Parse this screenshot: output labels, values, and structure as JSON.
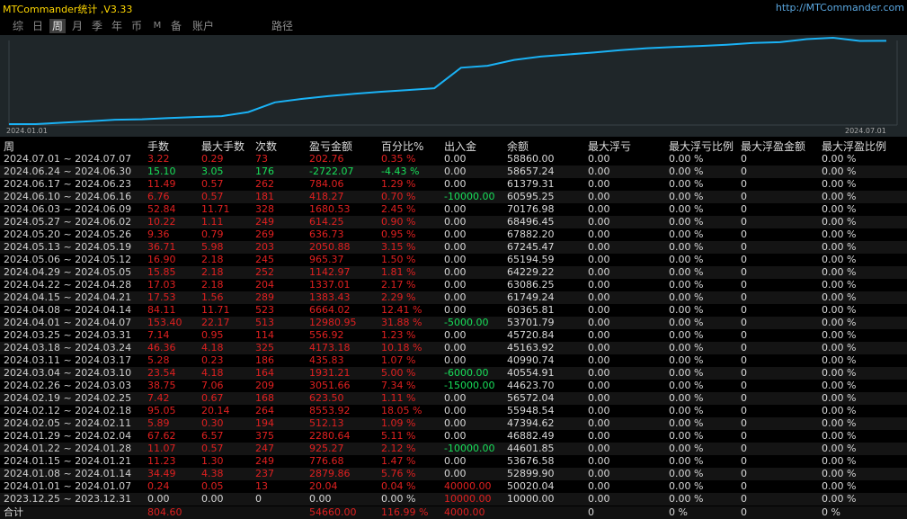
{
  "app": {
    "title": "MTCommander统计 ,V3.33",
    "url": "http://MTCommander.com"
  },
  "tabs": [
    {
      "label": "综",
      "active": false
    },
    {
      "label": "日",
      "active": false
    },
    {
      "label": "周",
      "active": true
    },
    {
      "label": "月",
      "active": false
    },
    {
      "label": "季",
      "active": false
    },
    {
      "label": "年",
      "active": false
    },
    {
      "label": "币",
      "active": false
    },
    {
      "label": "M",
      "active": false
    },
    {
      "label": "备",
      "active": false
    },
    {
      "label": "账户",
      "active": false
    },
    {
      "label": "路径",
      "active": false
    }
  ],
  "chart_data": {
    "type": "line",
    "x_start_label": "2024.01.01",
    "x_end_label": "2024.07.01",
    "series_color": "#1ab2f5",
    "grid": false,
    "values": [
      10000.0,
      10020.04,
      10796.72,
      11573.4,
      12498.67,
      12748.91,
      13460.0,
      14005.37,
      14520.12,
      16808.41,
      22335.7,
      24268.95,
      25862.33,
      27147.67,
      28345.25,
      29302.27,
      30339.7,
      41924.94,
      43049.76,
      46380.17,
      48244.88,
      49427.9,
      50571.39,
      51907.83,
      53016.2,
      53649.65,
      54280.32,
      54955.31,
      55961.27,
      56380.33,
      58116.25,
      58900.25,
      57127.64,
      57185.4
    ]
  },
  "table": {
    "headers": [
      "周",
      "手数",
      "最大手数",
      "次数",
      "盈亏金额",
      "百分比%",
      "出入金",
      "余额",
      "最大浮亏",
      "最大浮亏比例",
      "最大浮盈金额",
      "最大浮盈比例"
    ],
    "rows": [
      [
        "2024.07.01 ~ 2024.07.07",
        "3.22",
        "0.29",
        "73",
        "202.76",
        "0.35 %",
        "0.00",
        "58860.00",
        "0.00",
        "0.00 %",
        "0",
        "0.00 %"
      ],
      [
        "2024.06.24 ~ 2024.06.30",
        "15.10",
        "3.05",
        "176",
        "-2722.07",
        "-4.43 %",
        "0.00",
        "58657.24",
        "0.00",
        "0.00 %",
        "0",
        "0.00 %"
      ],
      [
        "2024.06.17 ~ 2024.06.23",
        "11.49",
        "0.57",
        "262",
        "784.06",
        "1.29 %",
        "0.00",
        "61379.31",
        "0.00",
        "0.00 %",
        "0",
        "0.00 %"
      ],
      [
        "2024.06.10 ~ 2024.06.16",
        "6.76",
        "0.57",
        "181",
        "418.27",
        "0.70 %",
        "-10000.00",
        "60595.25",
        "0.00",
        "0.00 %",
        "0",
        "0.00 %"
      ],
      [
        "2024.06.03 ~ 2024.06.09",
        "52.84",
        "11.71",
        "328",
        "1680.53",
        "2.45 %",
        "0.00",
        "70176.98",
        "0.00",
        "0.00 %",
        "0",
        "0.00 %"
      ],
      [
        "2024.05.27 ~ 2024.06.02",
        "10.22",
        "1.11",
        "249",
        "614.25",
        "0.90 %",
        "0.00",
        "68496.45",
        "0.00",
        "0.00 %",
        "0",
        "0.00 %"
      ],
      [
        "2024.05.20 ~ 2024.05.26",
        "9.36",
        "0.79",
        "269",
        "636.73",
        "0.95 %",
        "0.00",
        "67882.20",
        "0.00",
        "0.00 %",
        "0",
        "0.00 %"
      ],
      [
        "2024.05.13 ~ 2024.05.19",
        "36.71",
        "5.98",
        "203",
        "2050.88",
        "3.15 %",
        "0.00",
        "67245.47",
        "0.00",
        "0.00 %",
        "0",
        "0.00 %"
      ],
      [
        "2024.05.06 ~ 2024.05.12",
        "16.90",
        "2.18",
        "245",
        "965.37",
        "1.50 %",
        "0.00",
        "65194.59",
        "0.00",
        "0.00 %",
        "0",
        "0.00 %"
      ],
      [
        "2024.04.29 ~ 2024.05.05",
        "15.85",
        "2.18",
        "252",
        "1142.97",
        "1.81 %",
        "0.00",
        "64229.22",
        "0.00",
        "0.00 %",
        "0",
        "0.00 %"
      ],
      [
        "2024.04.22 ~ 2024.04.28",
        "17.03",
        "2.18",
        "204",
        "1337.01",
        "2.17 %",
        "0.00",
        "63086.25",
        "0.00",
        "0.00 %",
        "0",
        "0.00 %"
      ],
      [
        "2024.04.15 ~ 2024.04.21",
        "17.53",
        "1.56",
        "289",
        "1383.43",
        "2.29 %",
        "0.00",
        "61749.24",
        "0.00",
        "0.00 %",
        "0",
        "0.00 %"
      ],
      [
        "2024.04.08 ~ 2024.04.14",
        "84.11",
        "11.71",
        "523",
        "6664.02",
        "12.41 %",
        "0.00",
        "60365.81",
        "0.00",
        "0.00 %",
        "0",
        "0.00 %"
      ],
      [
        "2024.04.01 ~ 2024.04.07",
        "153.40",
        "22.17",
        "513",
        "12980.95",
        "31.88 %",
        "-5000.00",
        "53701.79",
        "0.00",
        "0.00 %",
        "0",
        "0.00 %"
      ],
      [
        "2024.03.25 ~ 2024.03.31",
        "7.14",
        "0.95",
        "114",
        "556.92",
        "1.23 %",
        "0.00",
        "45720.84",
        "0.00",
        "0.00 %",
        "0",
        "0.00 %"
      ],
      [
        "2024.03.18 ~ 2024.03.24",
        "46.36",
        "4.18",
        "325",
        "4173.18",
        "10.18 %",
        "0.00",
        "45163.92",
        "0.00",
        "0.00 %",
        "0",
        "0.00 %"
      ],
      [
        "2024.03.11 ~ 2024.03.17",
        "5.28",
        "0.23",
        "186",
        "435.83",
        "1.07 %",
        "0.00",
        "40990.74",
        "0.00",
        "0.00 %",
        "0",
        "0.00 %"
      ],
      [
        "2024.03.04 ~ 2024.03.10",
        "23.54",
        "4.18",
        "164",
        "1931.21",
        "5.00 %",
        "-6000.00",
        "40554.91",
        "0.00",
        "0.00 %",
        "0",
        "0.00 %"
      ],
      [
        "2024.02.26 ~ 2024.03.03",
        "38.75",
        "7.06",
        "209",
        "3051.66",
        "7.34 %",
        "-15000.00",
        "44623.70",
        "0.00",
        "0.00 %",
        "0",
        "0.00 %"
      ],
      [
        "2024.02.19 ~ 2024.02.25",
        "7.42",
        "0.67",
        "168",
        "623.50",
        "1.11 %",
        "0.00",
        "56572.04",
        "0.00",
        "0.00 %",
        "0",
        "0.00 %"
      ],
      [
        "2024.02.12 ~ 2024.02.18",
        "95.05",
        "20.14",
        "264",
        "8553.92",
        "18.05 %",
        "0.00",
        "55948.54",
        "0.00",
        "0.00 %",
        "0",
        "0.00 %"
      ],
      [
        "2024.02.05 ~ 2024.02.11",
        "5.89",
        "0.30",
        "194",
        "512.13",
        "1.09 %",
        "0.00",
        "47394.62",
        "0.00",
        "0.00 %",
        "0",
        "0.00 %"
      ],
      [
        "2024.01.29 ~ 2024.02.04",
        "67.62",
        "6.57",
        "375",
        "2280.64",
        "5.11 %",
        "0.00",
        "46882.49",
        "0.00",
        "0.00 %",
        "0",
        "0.00 %"
      ],
      [
        "2024.01.22 ~ 2024.01.28",
        "11.07",
        "0.57",
        "247",
        "925.27",
        "2.12 %",
        "-10000.00",
        "44601.85",
        "0.00",
        "0.00 %",
        "0",
        "0.00 %"
      ],
      [
        "2024.01.15 ~ 2024.01.21",
        "11.23",
        "1.30",
        "249",
        "776.68",
        "1.47 %",
        "0.00",
        "53676.58",
        "0.00",
        "0.00 %",
        "0",
        "0.00 %"
      ],
      [
        "2024.01.08 ~ 2024.01.14",
        "34.49",
        "4.38",
        "237",
        "2879.86",
        "5.76 %",
        "0.00",
        "52899.90",
        "0.00",
        "0.00 %",
        "0",
        "0.00 %"
      ],
      [
        "2024.01.01 ~ 2024.01.07",
        "0.24",
        "0.05",
        "13",
        "20.04",
        "0.04 %",
        "40000.00",
        "50020.04",
        "0.00",
        "0.00 %",
        "0",
        "0.00 %"
      ],
      [
        "2023.12.25 ~ 2023.12.31",
        "0.00",
        "0.00",
        "0",
        "0.00",
        "0.00 %",
        "10000.00",
        "10000.00",
        "0.00",
        "0.00 %",
        "0",
        "0.00 %"
      ]
    ],
    "total": [
      "合计",
      "804.60",
      "",
      "",
      "54660.00",
      "116.99 %",
      "4000.00",
      "",
      "0",
      "0 %",
      "0",
      "0 %"
    ]
  },
  "colors": {
    "loss_red": "#e02020",
    "deposit_green": "#18e05a",
    "chart_bg": "#1f2629",
    "accent_yellow": "#ffd700"
  }
}
